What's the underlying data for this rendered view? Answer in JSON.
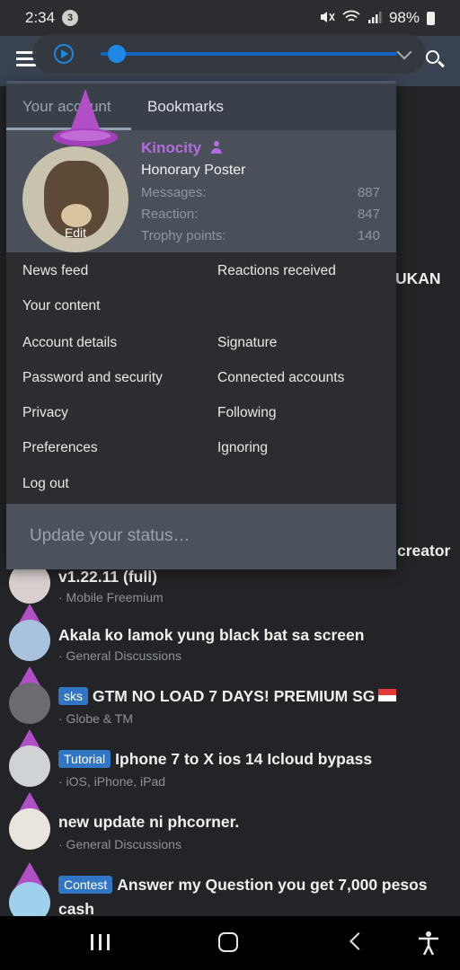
{
  "status_bar": {
    "time": "2:34",
    "notification_count": "3",
    "battery": "98%"
  },
  "tabs": [
    {
      "label": "Your account"
    },
    {
      "label": "Bookmarks"
    }
  ],
  "profile": {
    "username": "Kinocity",
    "rank": "Honorary Poster",
    "edit_label": "Edit",
    "stats": [
      {
        "label": "Messages:",
        "value": "887"
      },
      {
        "label": "Reaction:",
        "value": "847"
      },
      {
        "label": "Trophy points:",
        "value": "140"
      }
    ]
  },
  "menu": {
    "left": [
      "News feed",
      "Your content",
      "Account details",
      "Password and security",
      "Privacy",
      "Preferences",
      "Log out"
    ],
    "right": [
      "Reactions received",
      "Signature",
      "Connected accounts",
      "Following",
      "Ignoring"
    ]
  },
  "status_input": {
    "placeholder": "Update your status…"
  },
  "background": {
    "partial_1": "UKAN",
    "partial_2": "creator"
  },
  "threads": [
    {
      "tag": "",
      "title": "v1.22.11 (full)",
      "forum": "· Mobile Freemium"
    },
    {
      "tag": "",
      "title": "Akala ko lamok yung black bat sa screen",
      "forum": "· General Discussions"
    },
    {
      "tag": "sks",
      "title": "GTM NO LOAD 7 DAYS! PREMIUM SG",
      "forum": "· Globe & TM"
    },
    {
      "tag": "Tutorial",
      "title": "Iphone 7 to X ios 14 Icloud bypass",
      "forum": "· iOS, iPhone, iPad"
    },
    {
      "tag": "",
      "title": "new update ni phcorner.",
      "forum": "· General Discussions"
    },
    {
      "tag": "Contest",
      "title": "Answer my Question you get 7,000 pesos",
      "title_line2": "cash",
      "forum": ""
    }
  ],
  "colors": {
    "accent": "#3176c4",
    "username": "#b56ae0",
    "media_blue": "#1e88e5",
    "wizard_hat": "#b04fc6"
  },
  "icons": [
    "hamburger-icon",
    "search-icon",
    "play-icon",
    "wizard-hat-icon",
    "recent-apps-icon",
    "home-icon",
    "back-icon",
    "accessibility-icon"
  ]
}
